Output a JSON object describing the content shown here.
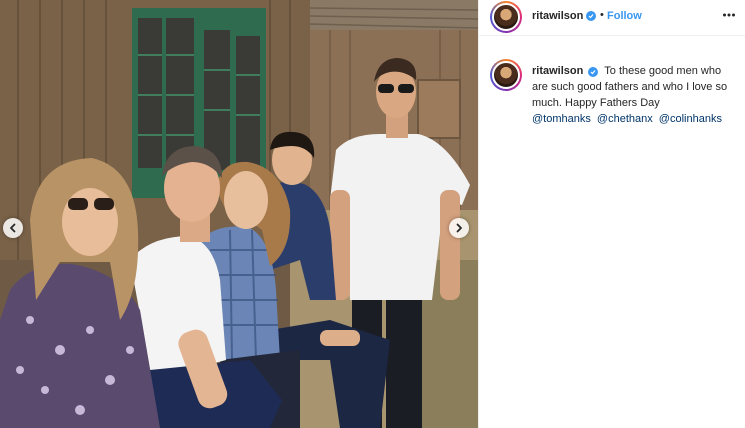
{
  "post": {
    "username": "ritawilson",
    "separator": "•",
    "follow_label": "Follow",
    "more_icon": "ellipsis-icon",
    "verified_icon": "verified-badge-icon",
    "caption": {
      "username": "ritawilson",
      "text": "To these good men who are such good fathers and who I love so much. Happy Fathers Day",
      "mentions": [
        "@tomhanks",
        "@chethanx",
        "@colinhanks"
      ]
    }
  },
  "carousel": {
    "prev_icon": "chevron-left-icon",
    "next_icon": "chevron-right-icon"
  },
  "colors": {
    "link_blue": "#3897f0",
    "mention_blue": "#003569",
    "text": "#262626",
    "border": "#efefef"
  }
}
